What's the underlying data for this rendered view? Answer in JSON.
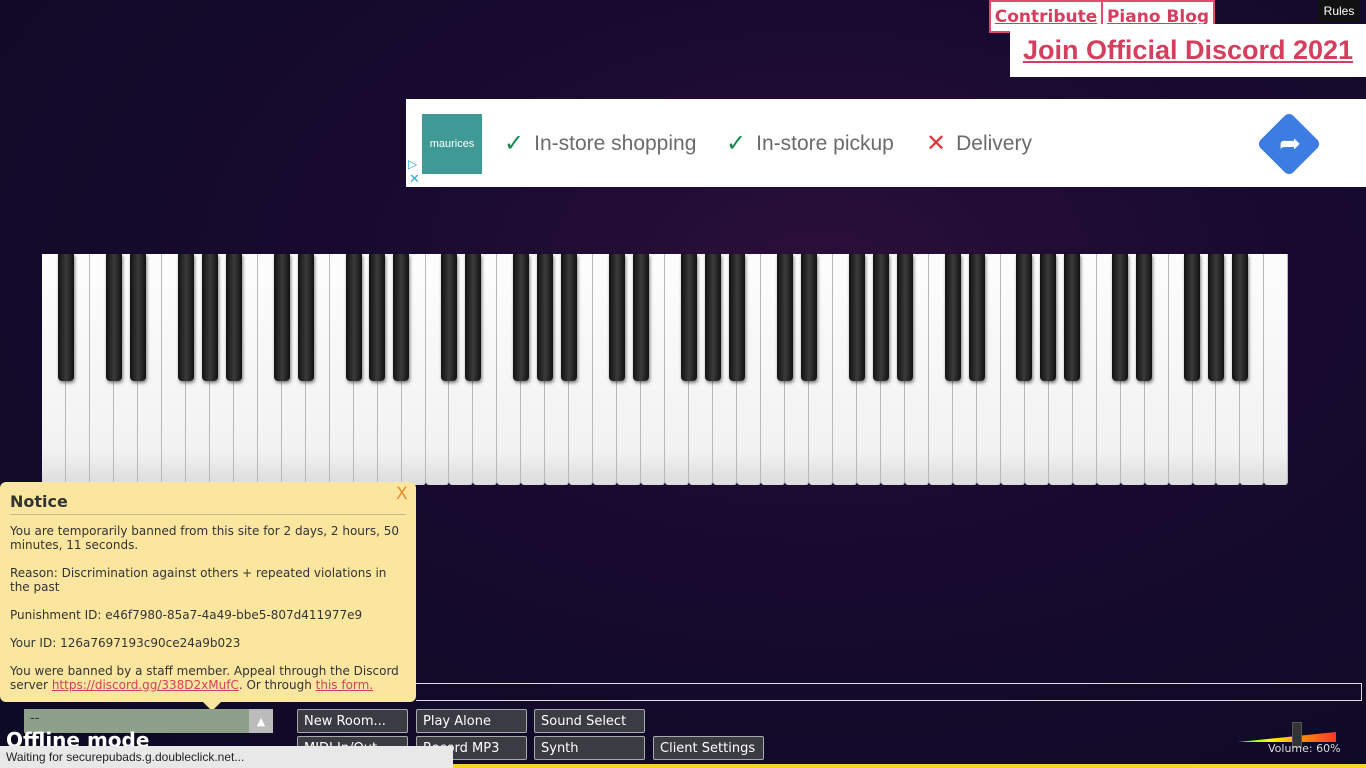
{
  "header": {
    "contribute": "Contribute",
    "piano_blog": "Piano Blog",
    "rules": "Rules",
    "discord": "Join Official Discord 2021"
  },
  "ad": {
    "brand": "maurices",
    "features": [
      {
        "mark": "✓",
        "label": "In-store shopping",
        "available": true
      },
      {
        "mark": "✓",
        "label": "In-store pickup",
        "available": true
      },
      {
        "mark": "✕",
        "label": "Delivery",
        "available": false
      }
    ],
    "adchoices_icon": "▷",
    "close_icon": "✕"
  },
  "piano": {
    "white_keys": 52,
    "black_keys": 36
  },
  "notice": {
    "title": "Notice",
    "close": "X",
    "ban_text": "You are temporarily banned from this site for 2 days, 2 hours, 50 minutes, 11 seconds.",
    "reason": "Reason: Discrimination against others + repeated violations in the past",
    "punishment_id": "Punishment ID: e46f7980-85a7-4a49-bbe5-807d411977e9",
    "your_id": "Your ID: 126a7697193c90ce24a9b023",
    "appeal_prefix": "You were banned by a staff member. Appeal through the Discord server ",
    "appeal_link": "https://discord.gg/338D2xMufC",
    "appeal_mid": ". Or through ",
    "form_link": "this form."
  },
  "controls": {
    "room_value": "--",
    "room_arrow": "▲",
    "new_room": "New Room...",
    "play_alone": "Play Alone",
    "sound_select": "Sound Select",
    "midi": "MIDI In/Out",
    "record": "Record MP3",
    "synth": "Synth",
    "client_settings": "Client Settings",
    "offline": "Offline mode",
    "volume_label": "Volume: 60%",
    "volume_level": 0.6
  },
  "status": {
    "text": "Waiting for securepubads.g.doubleclick.net..."
  },
  "colors": {
    "accent_link": "#d63e5e",
    "notice_bg": "#fbe6a0",
    "ad_go": "#3b7de0"
  }
}
